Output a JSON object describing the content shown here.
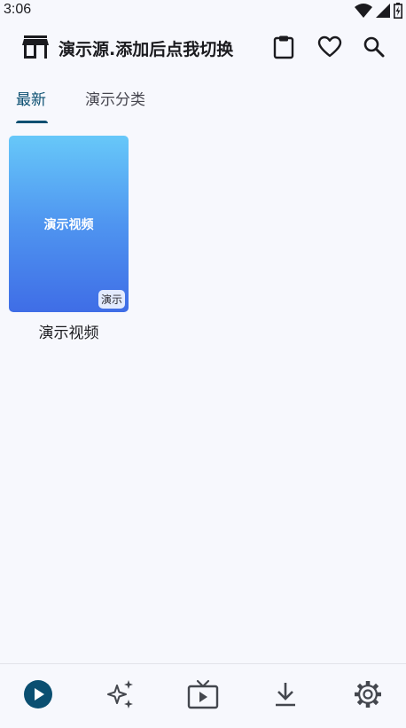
{
  "status": {
    "time": "3:06"
  },
  "app_bar": {
    "title": "演示源.添加后点我切换"
  },
  "tabs": [
    {
      "label": "最新",
      "selected": true
    },
    {
      "label": "演示分类",
      "selected": false
    }
  ],
  "videos": [
    {
      "thumb_text": "演示视频",
      "badge": "演示",
      "title": "演示视频"
    }
  ],
  "bottom_nav": [
    {
      "icon": "play-circle-icon",
      "active": true
    },
    {
      "icon": "sparkle-icon",
      "active": false
    },
    {
      "icon": "tv-icon",
      "active": false
    },
    {
      "icon": "download-icon",
      "active": false
    },
    {
      "icon": "settings-icon",
      "active": false
    }
  ],
  "colors": {
    "accent": "#0b4f71",
    "background": "#f7f8fd",
    "thumb_top": "#67c8f9",
    "thumb_bottom": "#3f6de6"
  }
}
